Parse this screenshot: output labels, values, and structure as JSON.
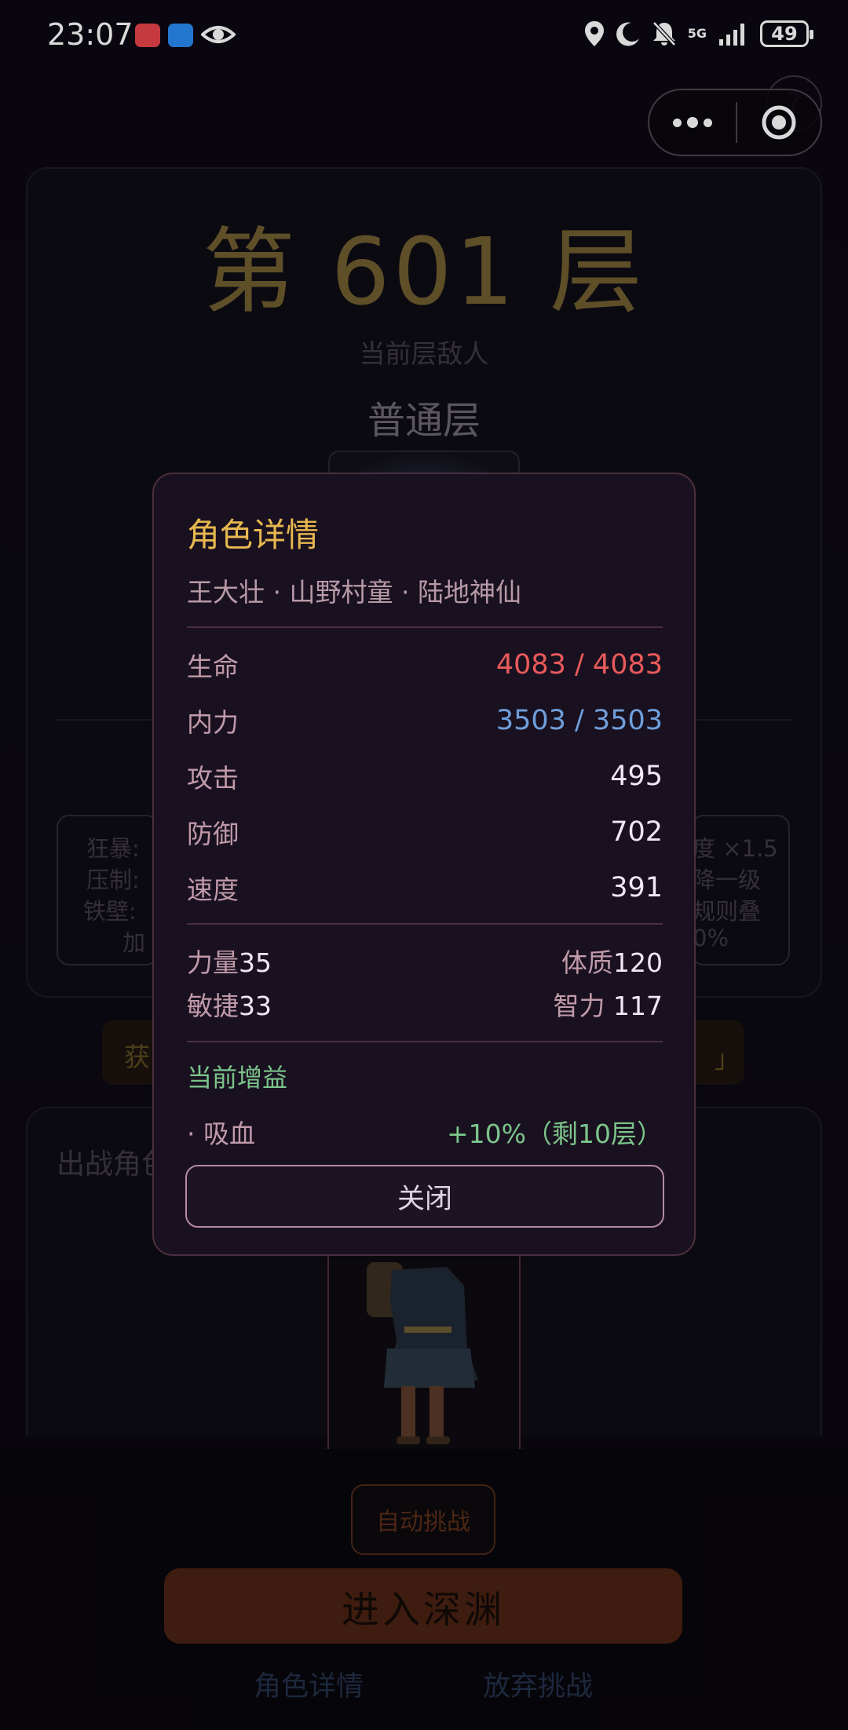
{
  "status_bar": {
    "time": "23:07",
    "network": "5G",
    "battery": "49",
    "icons": [
      "location-icon",
      "moon-icon",
      "bell-off-icon",
      "signal-icon"
    ]
  },
  "capsule": {
    "more_icon": "more-dots-icon",
    "close_icon": "target-circle-icon",
    "help_glyph": "?"
  },
  "floor": {
    "title": "第 601 层",
    "subtitle": "当前层敌人",
    "type": "普通层"
  },
  "rules": {
    "left": [
      "狂暴:",
      "压制:",
      "铁壁:",
      "加"
    ],
    "right": [
      "度 ×1.5",
      "降一级",
      "规则叠",
      "0%"
    ]
  },
  "reward": {
    "left": "获",
    "right": "」"
  },
  "team": {
    "label": "出战角色"
  },
  "actions": {
    "auto_challenge": "自动挑战",
    "enter_abyss": "进入深渊",
    "role_detail": "角色详情",
    "give_up": "放弃挑战"
  },
  "modal": {
    "title": "角色详情",
    "subtitle": "王大壮 · 山野村童 · 陆地神仙",
    "stats": [
      {
        "label": "生命",
        "value": "4083 / 4083"
      },
      {
        "label": "内力",
        "value": "3503 / 3503"
      },
      {
        "label": "攻击",
        "value": "495"
      },
      {
        "label": "防御",
        "value": "702"
      },
      {
        "label": "速度",
        "value": "391"
      }
    ],
    "attributes": {
      "strength_label": "力量",
      "strength": "35",
      "constitution_label": "体质",
      "constitution": "120",
      "agility_label": "敏捷",
      "agility": "33",
      "intellect_label": "智力",
      "intellect": " 117"
    },
    "buff_title": "当前增益",
    "buffs": [
      {
        "name": "· 吸血",
        "value": "+10%（剩10层）"
      }
    ],
    "close_label": "关闭"
  },
  "colors": {
    "accent_gold": "#e7b84f",
    "hp_red": "#ea5a5a",
    "mp_blue": "#6f9fdc",
    "buff_green": "#7bc58a"
  }
}
